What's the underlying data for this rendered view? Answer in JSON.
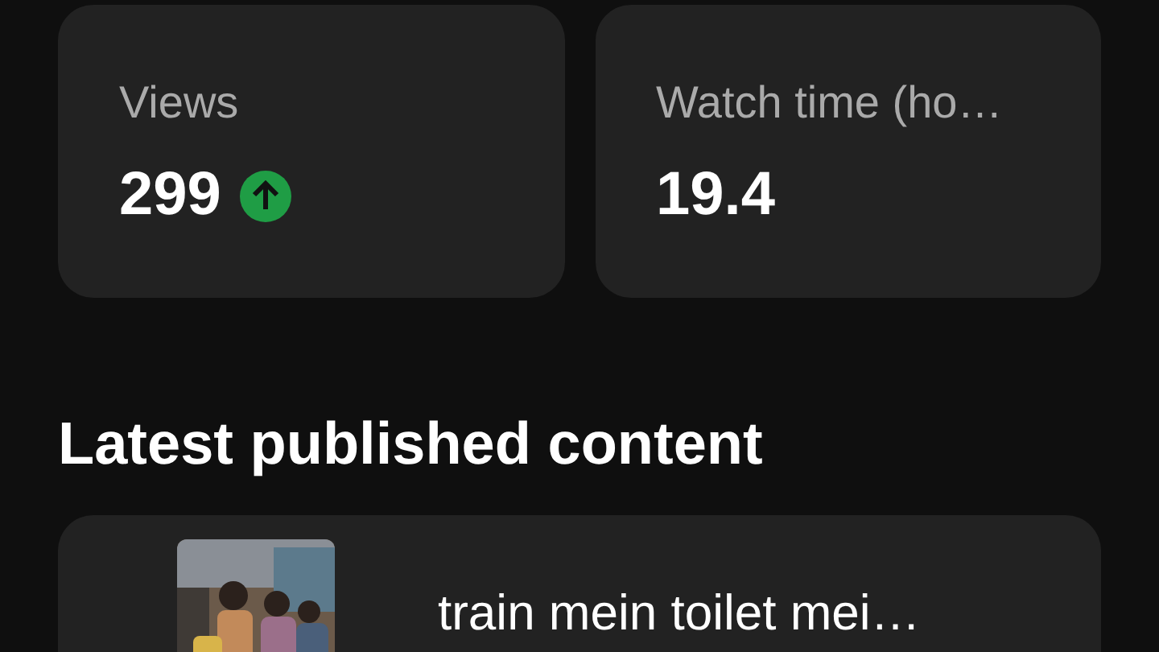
{
  "metrics": [
    {
      "label": "Views",
      "value": "299",
      "trending_up": true
    },
    {
      "label": "Watch time (ho…",
      "value": "19.4",
      "trending_up": false
    }
  ],
  "latest": {
    "heading": "Latest published content",
    "video": {
      "title": "train mein toilet mei…"
    }
  }
}
